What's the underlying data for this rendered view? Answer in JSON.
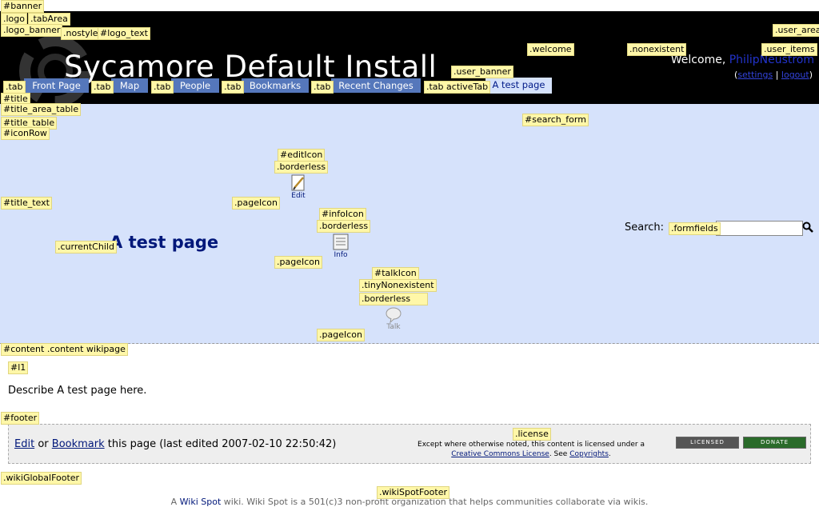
{
  "labels": {
    "banner": "#banner",
    "logo": ".logo",
    "tabArea": ".tabArea",
    "logo_banner": ".logo_banner",
    "nostyle": ".nostyle",
    "logo_text": "#logo_text",
    "user_area": ".user_area",
    "welcome": ".welcome",
    "nonexistent": ".nonexistent",
    "user_items": ".user_items",
    "user_banner": ".user_banner",
    "tab": ".tab",
    "tab_active": ".tab activeTab",
    "title": "#title",
    "title_area_table": "#title_area_table",
    "title_table": "#title_table",
    "iconRow": "#iconRow",
    "search_form": "#search_form",
    "editIcon": "#editIcon",
    "borderless": ".borderless",
    "title_text": "#title_text",
    "pageIcon": ".pageIcon",
    "infoIcon": "#infoIcon",
    "currentChild": ".currentChild",
    "formfields": ".formfields",
    "talkIcon": "#talkIcon",
    "tinyNonexistent": ".tinyNonexistent",
    "content": "#content .content wikipage",
    "l1": "#l1",
    "footer": "#footer",
    "license": ".license",
    "wikiGlobalFooter": ".wikiGlobalFooter",
    "wikiSpotFooter": ".wikiSpotFooter"
  },
  "header": {
    "logo_text": "Sycamore Default Install",
    "welcome": "Welcome,",
    "username": "PhilipNeustrom",
    "settings": "settings",
    "logout": "logout",
    "sep": "|",
    "paren_open": "(",
    "paren_close": ")"
  },
  "tabs": [
    {
      "label": "Front Page"
    },
    {
      "label": "Map"
    },
    {
      "label": "People"
    },
    {
      "label": "Bookmarks"
    },
    {
      "label": "Recent Changes"
    },
    {
      "label": "A test page"
    }
  ],
  "title": {
    "page_title": "A test page",
    "edit_label": "Edit",
    "info_label": "Info",
    "talk_label": "Talk",
    "search_label": "Search:",
    "search_value": ""
  },
  "content": {
    "text": "Describe A test page here."
  },
  "footer": {
    "edit": "Edit",
    "or": "or",
    "bookmark": "Bookmark",
    "rest": "this page (last edited 2007-02-10 22:50:42)",
    "license_line1": "Except where otherwise noted, this content is licensed under a",
    "cc_link": "Creative Commons License",
    "see": ". See",
    "copyrights": "Copyrights",
    "dot": ".",
    "badge_licensed": "LICENSED",
    "badge_donate": "DONATE"
  },
  "global_footer": {
    "a": "A",
    "wiki_spot": "Wiki Spot",
    "rest": "wiki. Wiki Spot is a 501(c)3 non-profit organization that helps communities collaborate via wikis."
  },
  "colors": {
    "banner_bg": "#000000",
    "tab_bg": "#5577bb",
    "active_tab_bg": "#d5e2fb",
    "title_area_bg": "#d6e2fb",
    "title_color": "#00177a",
    "label_bg": "#fff7a8"
  }
}
